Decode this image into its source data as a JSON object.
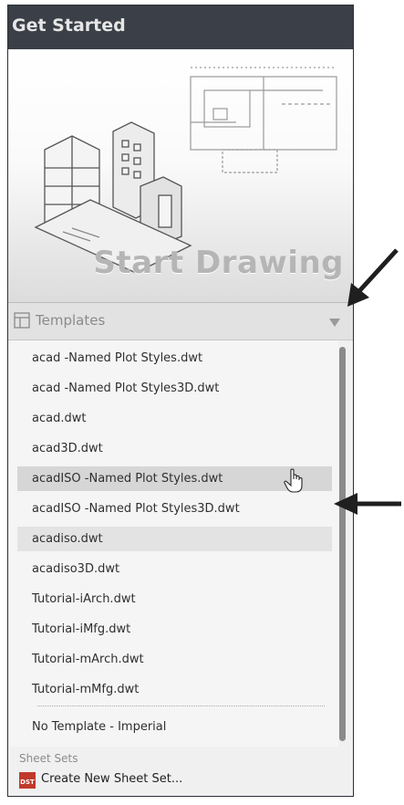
{
  "header": {
    "title": "Get Started"
  },
  "hero": {
    "label": "Start Drawing"
  },
  "templates": {
    "label": "Templates",
    "items": [
      "acad -Named Plot Styles.dwt",
      "acad -Named Plot Styles3D.dwt",
      "acad.dwt",
      "acad3D.dwt",
      "acadISO -Named Plot Styles.dwt",
      "acadISO -Named Plot Styles3D.dwt",
      "acadiso.dwt",
      "acadiso3D.dwt",
      "Tutorial-iArch.dwt",
      "Tutorial-iMfg.dwt",
      "Tutorial-mArch.dwt",
      "Tutorial-mMfg.dwt"
    ],
    "extra_item": "No Template - Imperial",
    "hovered_item": "acadISO -Named Plot Styles.dwt",
    "selected_item": "acadiso.dwt"
  },
  "sheet_sets": {
    "label": "Sheet Sets",
    "create_label": "Create New Sheet Set...",
    "icon_text": "DST"
  },
  "icons": {
    "templates": "templates-grid-icon",
    "dropdown": "chevron-down-icon",
    "cursor": "hand-pointer-icon",
    "sheet_set": "dst-file-icon",
    "callout": "black-arrow-icon"
  },
  "colors": {
    "header_bg": "#3b3f47",
    "header_text": "#e6e6e6",
    "hero_text": "#b5b5b5",
    "hover_bg": "#d6d6d6",
    "selected_bg": "#e3e3e3",
    "sheet_icon": "#c0392b"
  }
}
